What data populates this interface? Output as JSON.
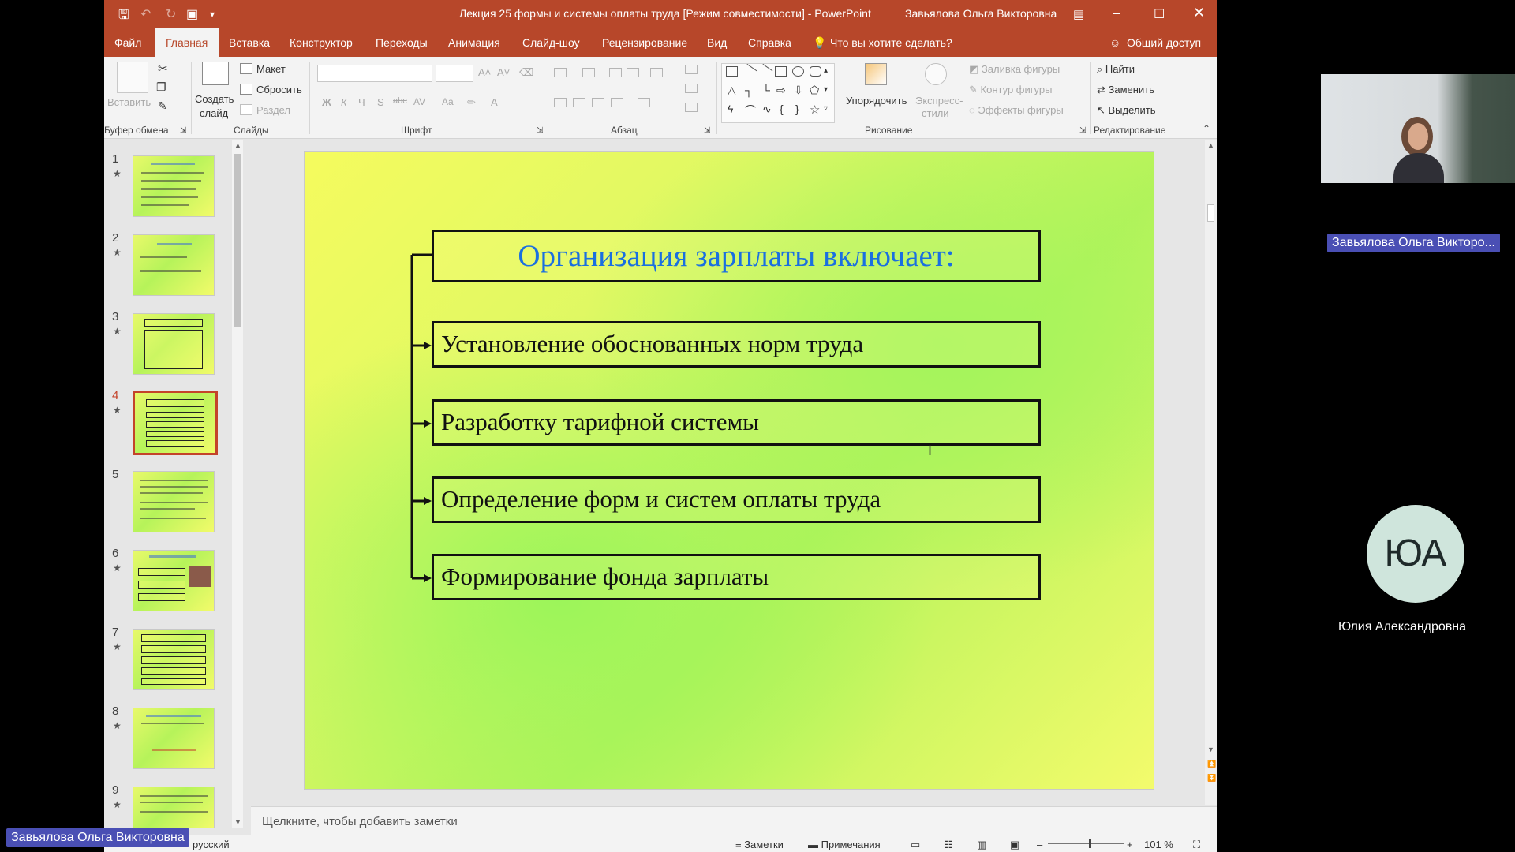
{
  "app": {
    "title": "Лекция 25 формы и системы оплаты труда [Режим совместимости]  -  PowerPoint",
    "user": "Завьялова Ольга Викторовна"
  },
  "tabs": [
    "Файл",
    "Главная",
    "Вставка",
    "Конструктор",
    "Переходы",
    "Анимация",
    "Слайд-шоу",
    "Рецензирование",
    "Вид",
    "Справка"
  ],
  "tell_me": "Что вы хотите сделать?",
  "share": "Общий доступ",
  "ribbon": {
    "clipboard": {
      "paste": "Вставить",
      "label": "Буфер обмена"
    },
    "slides": {
      "new_slide_1": "Создать",
      "new_slide_2": "слайд",
      "layout": "Макет",
      "reset": "Сбросить",
      "section": "Раздел",
      "label": "Слайды"
    },
    "font": {
      "bold": "Ж",
      "italic": "К",
      "underline": "Ч",
      "shadow": "S",
      "strike": "abc",
      "spacing": "AV",
      "case": "Aa",
      "label": "Шрифт"
    },
    "paragraph": {
      "label": "Абзац"
    },
    "drawing": {
      "arrange": "Упорядочить",
      "quick_styles_1": "Экспресс-",
      "quick_styles_2": "стили",
      "fill": "Заливка фигуры",
      "outline": "Контур фигуры",
      "effects": "Эффекты фигуры",
      "label": "Рисование"
    },
    "editing": {
      "find": "Найти",
      "replace": "Заменить",
      "select": "Выделить",
      "label": "Редактирование"
    }
  },
  "thumbnails": [
    "1",
    "2",
    "3",
    "4",
    "5",
    "6",
    "7",
    "8",
    "9"
  ],
  "selected_slide": 4,
  "slide": {
    "title": "Организация зарплаты включает:",
    "items": [
      "Установление обоснованных норм труда",
      "Разработку тарифной системы",
      "Определение форм и систем оплаты труда",
      "Формирование фонда зарплаты"
    ]
  },
  "notes_placeholder": "Щелкните, чтобы добавить заметки",
  "status": {
    "language": "русский",
    "notes": "Заметки",
    "comments": "Примечания",
    "zoom": "101 %"
  },
  "conference": {
    "presenter_badge": "Завьялова Ольга Викторо...",
    "bottom_badge": "Завьялова Ольга Викторовна",
    "participant_initials": "ЮА",
    "participant_name": "Юлия Александровна"
  },
  "colors": {
    "accent": "#b7472a",
    "slide_title": "#1a6fe0",
    "badge": "#4a4fb4"
  }
}
